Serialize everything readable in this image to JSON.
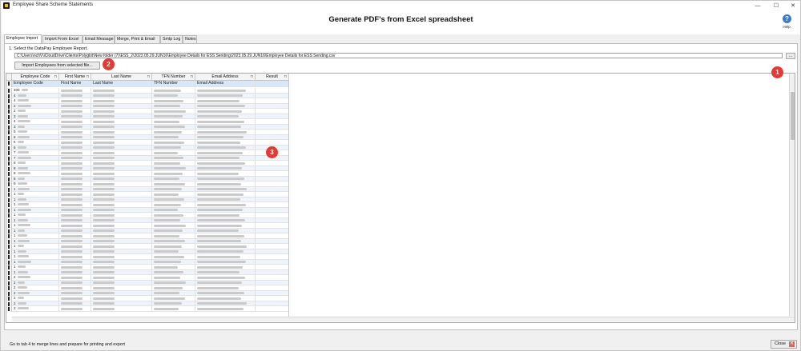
{
  "window": {
    "title": "Employee Share Scheme Statements",
    "minimize": "—",
    "maximize": "☐",
    "close": "✕"
  },
  "header": {
    "title": "Generate PDF's from Excel spreadsheet",
    "help_label": "Help",
    "help_icon": "?"
  },
  "tabs": [
    {
      "label": "Employee Import",
      "active": true
    },
    {
      "label": "Import From Excel"
    },
    {
      "label": "Email Message"
    },
    {
      "label": "Merge, Print & Email"
    },
    {
      "label": "Smtp Log"
    },
    {
      "label": "Notes"
    }
  ],
  "import": {
    "instruction": "1.  Select the DataPay Employee Report.",
    "path": "C:\\Users\\nchV\\iCloudDrive\\Clients\\Polyglot\\New folder (7)\\ESS_2\\2023.05.29.JUN16\\Employee Details for ESS Sending\\2023.05.29.JUN16\\Employee Details for ESS Sending.csv",
    "browse_label": "...",
    "button_label": "Import Employees from selected file..."
  },
  "grid": {
    "columns": [
      "Employee Code",
      "First Name",
      "Last Name",
      "TFN Number",
      "Email Address",
      "Result"
    ],
    "filter_rows": [
      "Employee Code",
      "First Name",
      "Last Name",
      "TFN Number",
      "Email Address"
    ],
    "first_row_code": "400",
    "row_codes": [
      "400",
      "4",
      "4",
      "2",
      "2",
      "3",
      "4",
      "3",
      "5",
      "6",
      "6",
      "6",
      "7",
      "7",
      "8",
      "8",
      "8",
      "8",
      "9",
      "1",
      "1",
      "1",
      "1",
      "1",
      "1",
      "1",
      "1",
      "1",
      "1",
      "1",
      "1",
      "1",
      "1",
      "1",
      "1",
      "1",
      "2",
      "2",
      "2",
      "2",
      "2",
      "2",
      "2",
      "2",
      "2",
      "2"
    ]
  },
  "badges": [
    "1",
    "2",
    "3"
  ],
  "status": {
    "message": "Go to tab 4 to merge lines and prepare for printing and export",
    "close_label": "Close",
    "close_icon": "✕"
  }
}
